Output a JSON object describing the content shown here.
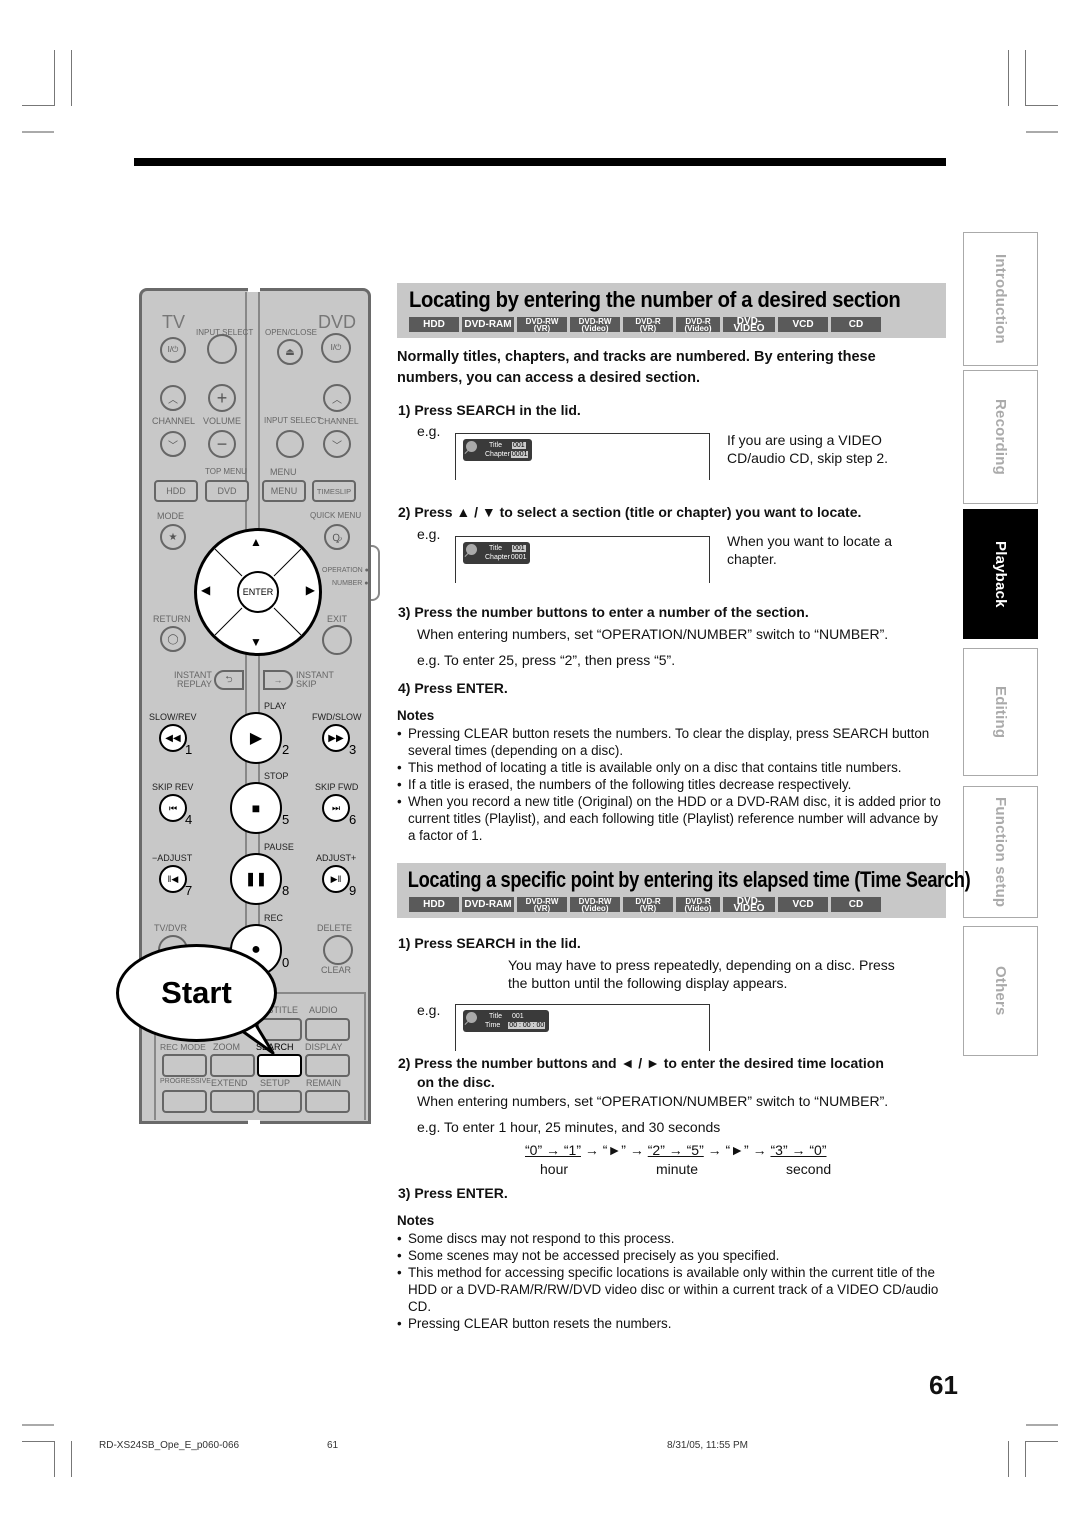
{
  "page_number": "61",
  "footer": {
    "file": "RD-XS24SB_Ope_E_p060-066",
    "page": "61",
    "timestamp": "8/31/05, 11:55 PM"
  },
  "side_tabs": [
    {
      "label": "Introduction",
      "active": false
    },
    {
      "label": "Recording",
      "active": false
    },
    {
      "label": "Playback",
      "active": true
    },
    {
      "label": "Editing",
      "active": false
    },
    {
      "label": "Function setup",
      "active": false
    },
    {
      "label": "Others",
      "active": false
    }
  ],
  "disc_badges": [
    {
      "line1": "HDD",
      "line2": ""
    },
    {
      "line1": "DVD-RAM",
      "line2": ""
    },
    {
      "line1": "DVD-RW",
      "line2": "(VR)"
    },
    {
      "line1": "DVD-RW",
      "line2": "(Video)"
    },
    {
      "line1": "DVD-R",
      "line2": "(VR)"
    },
    {
      "line1": "DVD-R",
      "line2": "(Video)"
    },
    {
      "line1": "DVD-VIDEO",
      "line2": ""
    },
    {
      "line1": "VCD",
      "line2": ""
    },
    {
      "line1": "CD",
      "line2": ""
    }
  ],
  "section1": {
    "title": "Locating by entering the number of a desired section",
    "intro": [
      "Normally titles, chapters, and tracks are numbered. By entering these",
      "numbers, you can access a desired section."
    ],
    "step1": "1)  Press SEARCH in the lid.",
    "eg": "e.g.",
    "step1_side": [
      "If you are using a VIDEO",
      "CD/audio CD, skip step 2."
    ],
    "osd1": {
      "search": "Search",
      "title_label": "Title",
      "title_value": "001",
      "chapter_label": "Chapter",
      "chapter_value": "0001"
    },
    "step2": "2)  Press ▲ / ▼ to select a section (title or chapter) you want to locate.",
    "step2_side": [
      "When you want to locate a",
      "chapter."
    ],
    "osd2": {
      "search": "Search",
      "title_label": "Title",
      "title_value": "001",
      "chapter_label": "Chapter",
      "chapter_value": "0001"
    },
    "step3": "3)  Press the number buttons to enter a number of the section.",
    "step3_body": "When entering numbers, set “OPERATION/NUMBER” switch to “NUMBER”.",
    "step3_eg": "e.g. To enter 25, press “2”, then press “5”.",
    "step4": "4)  Press ENTER.",
    "notes_title": "Notes",
    "notes": [
      "Pressing CLEAR button resets the numbers. To clear the display, press SEARCH button several times (depending on a disc).",
      "This method of locating a title is available only on a disc that contains title numbers.",
      "If a title is erased, the numbers of the following titles decrease respectively.",
      "When you record a new title (Original) on the HDD or a DVD-RAM disc, it is added prior to current titles (Playlist), and each following title (Playlist) reference number will advance by a factor of 1."
    ]
  },
  "section2": {
    "title": "Locating a specific point by entering its elapsed time (Time Search)",
    "step1": "1)  Press SEARCH in the lid.",
    "step1_body": [
      "You may have to press repeatedly, depending on a disc. Press",
      "the button until the following display appears."
    ],
    "eg": "e.g.",
    "osd": {
      "search": "Search",
      "title_label": "Title",
      "title_value": "001",
      "time_label": "Time",
      "time_value": "00 : 00 : 00"
    },
    "step2": "2)  Press the number buttons and ◄ / ► to enter the desired time location",
    "step2_cont": "on the disc.",
    "step2_body": "When entering numbers, set “OPERATION/NUMBER” switch to “NUMBER”.",
    "step2_eg": "e.g. To enter 1 hour, 25 minutes, and 30 seconds",
    "sequence": {
      "hour": "“0” → “1”",
      "arrow1": " → “►” → ",
      "minute": "“2” → “5”",
      "arrow2": " → “►” → ",
      "second": "“3” → “0”"
    },
    "sequence_labels": {
      "hour": "hour",
      "minute": "minute",
      "second": "second"
    },
    "step3": "3)  Press ENTER.",
    "notes_title": "Notes",
    "notes": [
      "Some discs may not respond to this process.",
      "Some scenes may not be accessed precisely as you specified.",
      "This method for accessing specific locations is available only within the current title of the HDD or a DVD-RAM/R/RW/DVD video disc or within a current track of a VIDEO CD/audio CD.",
      "Pressing CLEAR button resets the numbers."
    ]
  },
  "remote": {
    "tv": "TV",
    "dvd": "DVD",
    "input_select": "INPUT SELECT",
    "open_close": "OPEN/CLOSE",
    "power": "I/⏻",
    "channel": "CHANNEL",
    "volume": "VOLUME",
    "input_select2": "INPUT SELECT",
    "channel2": "CHANNEL",
    "top_menu": "TOP MENU",
    "menu_top": "MENU",
    "hdd": "HDD",
    "dvd_btn": "DVD",
    "menu": "MENU",
    "timeslip": "TIMESLIP",
    "mode": "MODE",
    "quick_menu": "QUICK MENU",
    "enter": "ENTER",
    "operation": "OPERATION ●",
    "number": "NUMBER ●",
    "return": "RETURN",
    "exit": "EXIT",
    "instant_replay": [
      "INSTANT",
      "REPLAY"
    ],
    "instant_skip": [
      "INSTANT",
      "SKIP"
    ],
    "play": "PLAY",
    "slow_rev": "SLOW/REV",
    "fwd_slow": "FWD/SLOW",
    "stop": "STOP",
    "skip_rev": "SKIP REV",
    "skip_fwd": "SKIP FWD",
    "pause": "PAUSE",
    "adjust_minus": "−ADJUST",
    "adjust_plus": "ADJUST+",
    "rec": "REC",
    "tv_dvr": "TV/DVR",
    "delete": "DELETE",
    "clear": "CLEAR",
    "subtitle": "SUBTITLE",
    "audio": "AUDIO",
    "rec_mode": "REC MODE",
    "zoom": "ZOOM",
    "search": "SEARCH",
    "display": "DISPLAY",
    "progressive": "PROGRESSIVE",
    "extend": "EXTEND",
    "setup": "SETUP",
    "remain": "REMAIN",
    "numbers": [
      "1",
      "2",
      "3",
      "4",
      "5",
      "6",
      "7",
      "8",
      "9",
      "0"
    ],
    "callout": "Start"
  }
}
